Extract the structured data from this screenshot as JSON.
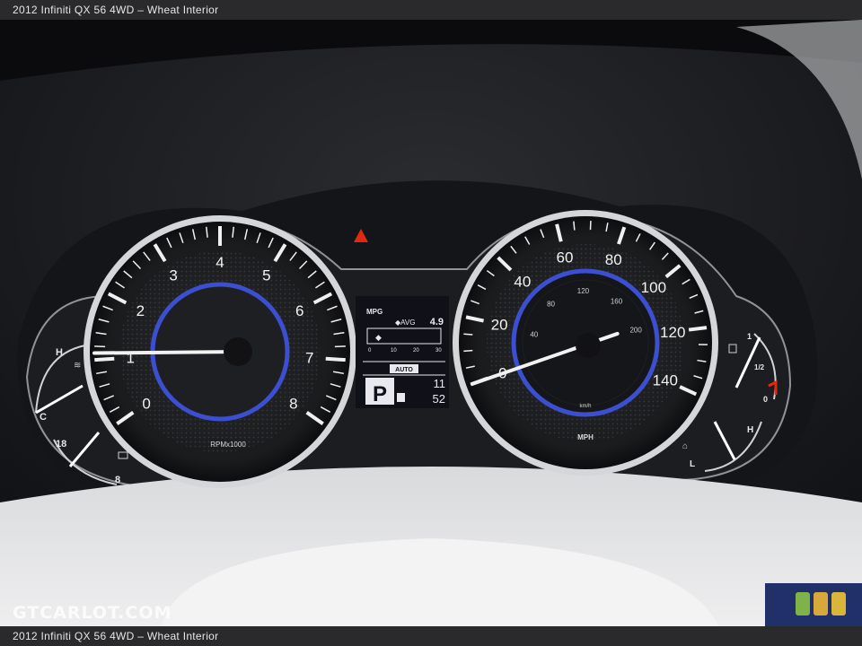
{
  "caption": {
    "top": "2012 Infiniti QX 56 4WD – Wheat Interior",
    "bottom": "2012 Infiniti QX 56 4WD – Wheat Interior"
  },
  "watermark": "GTCARLOT.COM",
  "tachometer": {
    "labels": [
      "0",
      "1",
      "2",
      "3",
      "4",
      "5",
      "6",
      "7",
      "8"
    ],
    "unit": "RPMx1000",
    "needle_rpm_x1000": 1.1
  },
  "speedometer": {
    "mph_labels": [
      "0",
      "20",
      "40",
      "60",
      "80",
      "100",
      "120",
      "140"
    ],
    "kmh_labels": [
      "40",
      "80",
      "120",
      "160",
      "200"
    ],
    "unit": "MPH",
    "inner_unit": "km/h",
    "needle_mph": 0
  },
  "center_display": {
    "mpg_label": "MPG",
    "avg_label": "◆AVG",
    "avg_value": "4.9",
    "scale": [
      "0",
      "10",
      "20",
      "30"
    ],
    "mode": "AUTO",
    "gear": "P",
    "time_hours": "11",
    "time_minutes": "52"
  },
  "temp_gauge": {
    "high": "H",
    "low": "C"
  },
  "voltage_gauge": {
    "high": "18",
    "low": "8"
  },
  "fuel_gauge": {
    "full": "1",
    "half": "1/2",
    "empty": "0"
  },
  "oil_gauge": {
    "high": "H",
    "low": "L"
  },
  "colors": {
    "accent_blue": "#3b4fd0",
    "warning_red": "#e02a10",
    "chrome": "#cfd2d6"
  }
}
